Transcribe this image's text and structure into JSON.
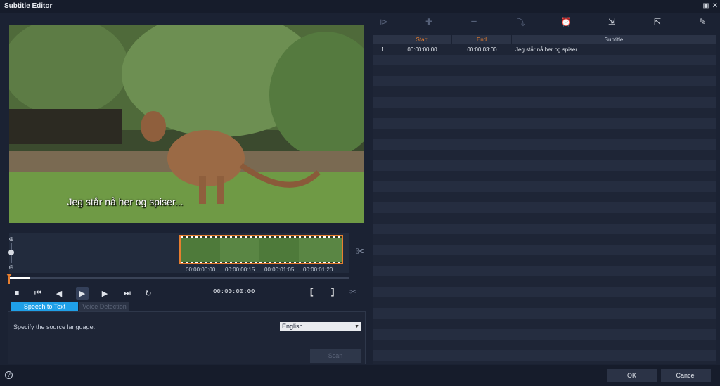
{
  "window": {
    "title": "Subtitle Editor"
  },
  "preview": {
    "subtitle_text": "Jeg står nå her og spiser..."
  },
  "timeline": {
    "timecodes": [
      "00:00:00:00",
      "00:00:00:15",
      "00:00:01:05",
      "00:00:01:20"
    ]
  },
  "playback": {
    "timecode": "00:00:00:00"
  },
  "tabs": {
    "speech_to_text": "Speech to Text",
    "voice_detection": "Voice Detection"
  },
  "speech_panel": {
    "language_label": "Specify the source language:",
    "language_value": "English",
    "scan_label": "Scan"
  },
  "subtitle_table": {
    "headers": {
      "start": "Start",
      "end": "End",
      "subtitle": "Subtitle"
    },
    "rows": [
      {
        "index": "1",
        "start": "00:00:00:00",
        "end": "00:00:03:00",
        "text": "Jeg står nå her og spiser..."
      }
    ]
  },
  "footer": {
    "ok_label": "OK",
    "cancel_label": "Cancel",
    "help_icon": "?"
  },
  "colors": {
    "accent": "#e77e2f",
    "tab_active": "#1fa0e8",
    "background": "#1b2233"
  }
}
